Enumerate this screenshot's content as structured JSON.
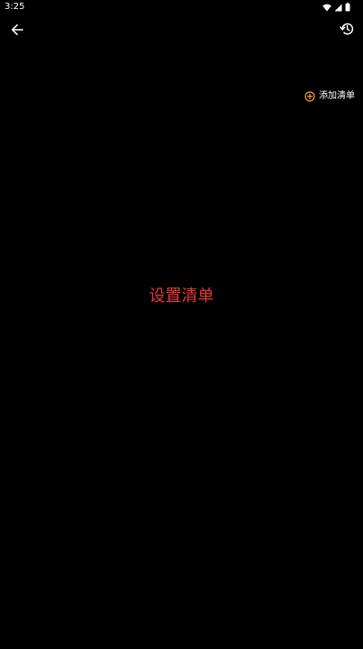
{
  "status_bar": {
    "time": "3:25",
    "icons": [
      "wifi-icon",
      "cell-signal-icon",
      "battery-icon"
    ]
  },
  "toolbar": {
    "back_icon": "arrow-left-icon",
    "history_icon": "history-icon"
  },
  "add_list": {
    "label": "添加清单",
    "icon": "plus-circle-icon",
    "icon_color": "#f0a040"
  },
  "main": {
    "title": "设置清单",
    "title_color": "#e53935"
  },
  "colors": {
    "background": "#000000",
    "text": "#ffffff"
  }
}
